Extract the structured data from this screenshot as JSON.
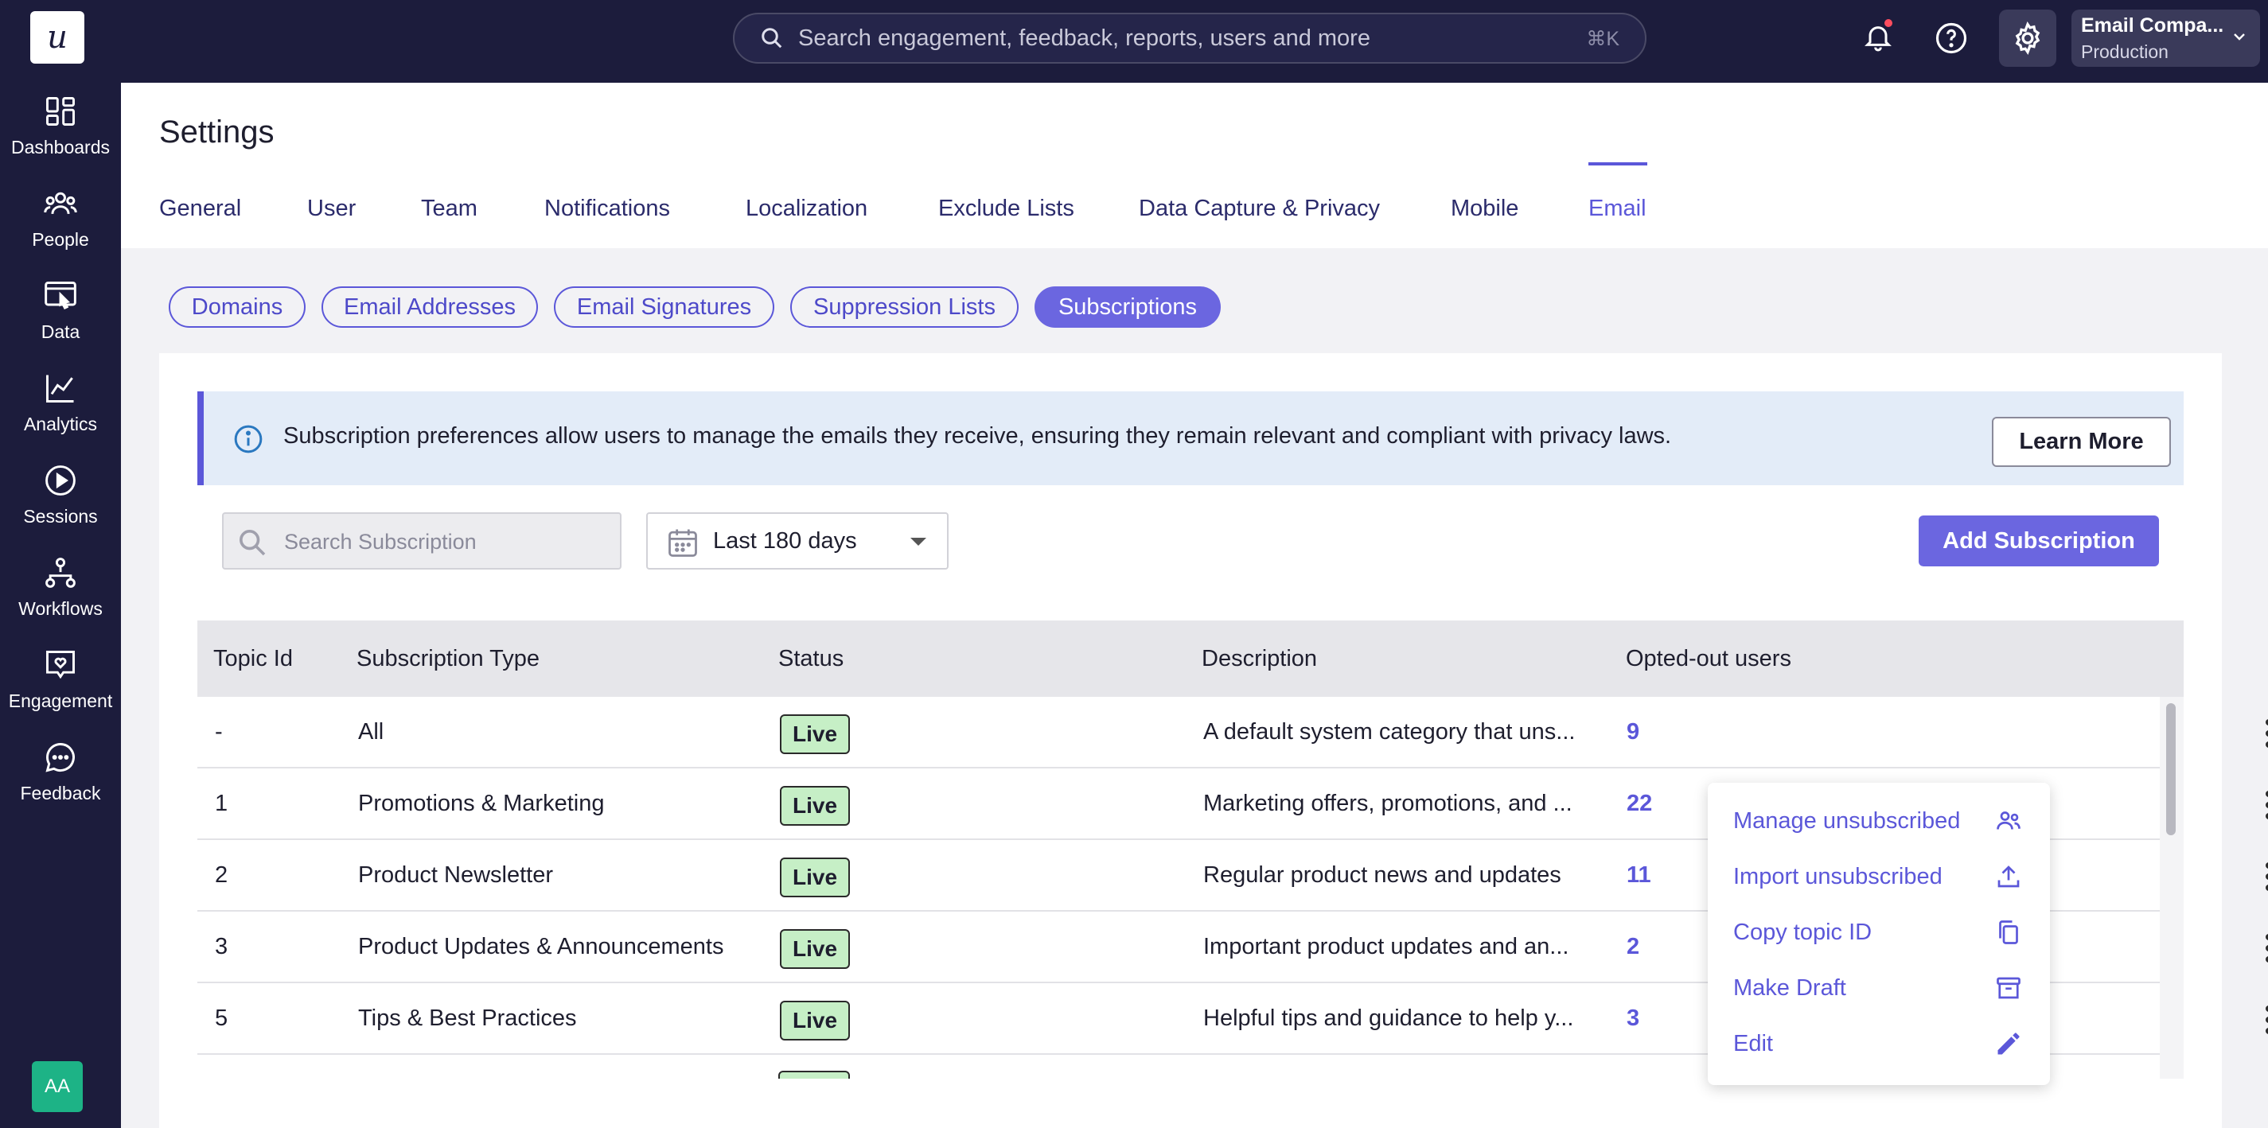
{
  "app": {
    "logo_glyph": "u",
    "search_placeholder": "Search engagement, feedback, reports, users and more",
    "search_shortcut": "⌘K",
    "account_name": "Email Compa...",
    "account_env": "Production",
    "avatar_initials": "AA",
    "accent_color": "#5b57d9"
  },
  "sidebar": {
    "items": [
      {
        "label": "Dashboards",
        "icon": "dashboards-icon"
      },
      {
        "label": "People",
        "icon": "people-icon"
      },
      {
        "label": "Data",
        "icon": "data-icon"
      },
      {
        "label": "Analytics",
        "icon": "analytics-icon"
      },
      {
        "label": "Sessions",
        "icon": "sessions-icon"
      },
      {
        "label": "Workflows",
        "icon": "workflows-icon"
      },
      {
        "label": "Engagement",
        "icon": "engagement-icon"
      },
      {
        "label": "Feedback",
        "icon": "feedback-icon"
      }
    ]
  },
  "page": {
    "title": "Settings",
    "tabs": [
      {
        "label": "General"
      },
      {
        "label": "User"
      },
      {
        "label": "Team"
      },
      {
        "label": "Notifications"
      },
      {
        "label": "Localization"
      },
      {
        "label": "Exclude Lists"
      },
      {
        "label": "Data Capture & Privacy"
      },
      {
        "label": "Mobile"
      },
      {
        "label": "Email",
        "active": true
      }
    ],
    "subtabs": [
      {
        "label": "Domains"
      },
      {
        "label": "Email Addresses"
      },
      {
        "label": "Email Signatures"
      },
      {
        "label": "Suppression Lists"
      },
      {
        "label": "Subscriptions",
        "active": true
      }
    ]
  },
  "banner": {
    "text": "Subscription preferences allow users to manage the emails they receive, ensuring they remain relevant and compliant with privacy laws.",
    "button": "Learn More"
  },
  "toolbar": {
    "search_placeholder": "Search Subscription",
    "date_range": "Last 180 days",
    "add_button": "Add Subscription"
  },
  "table": {
    "headers": [
      "Topic Id",
      "Subscription Type",
      "Status",
      "Description",
      "Opted-out users"
    ],
    "rows": [
      {
        "id": "-",
        "type": "All",
        "status": "Live",
        "description": "A default system category that uns...",
        "opted_out": "9"
      },
      {
        "id": "1",
        "type": "Promotions & Marketing",
        "status": "Live",
        "description": "Marketing offers, promotions, and ...",
        "opted_out": "22"
      },
      {
        "id": "2",
        "type": "Product Newsletter",
        "status": "Live",
        "description": "Regular product news and updates",
        "opted_out": "11"
      },
      {
        "id": "3",
        "type": "Product Updates & Announcements",
        "status": "Live",
        "description": "Important product updates and an...",
        "opted_out": "2"
      },
      {
        "id": "5",
        "type": "Tips & Best Practices",
        "status": "Live",
        "description": "Helpful tips and guidance to help y...",
        "opted_out": "3"
      }
    ]
  },
  "row_menu": {
    "items": [
      {
        "label": "Manage unsubscribed",
        "icon": "people-icon"
      },
      {
        "label": "Import unsubscribed",
        "icon": "upload-icon"
      },
      {
        "label": "Copy topic ID",
        "icon": "copy-icon"
      },
      {
        "label": "Make Draft",
        "icon": "archive-icon"
      },
      {
        "label": "Edit",
        "icon": "pencil-icon"
      }
    ]
  }
}
